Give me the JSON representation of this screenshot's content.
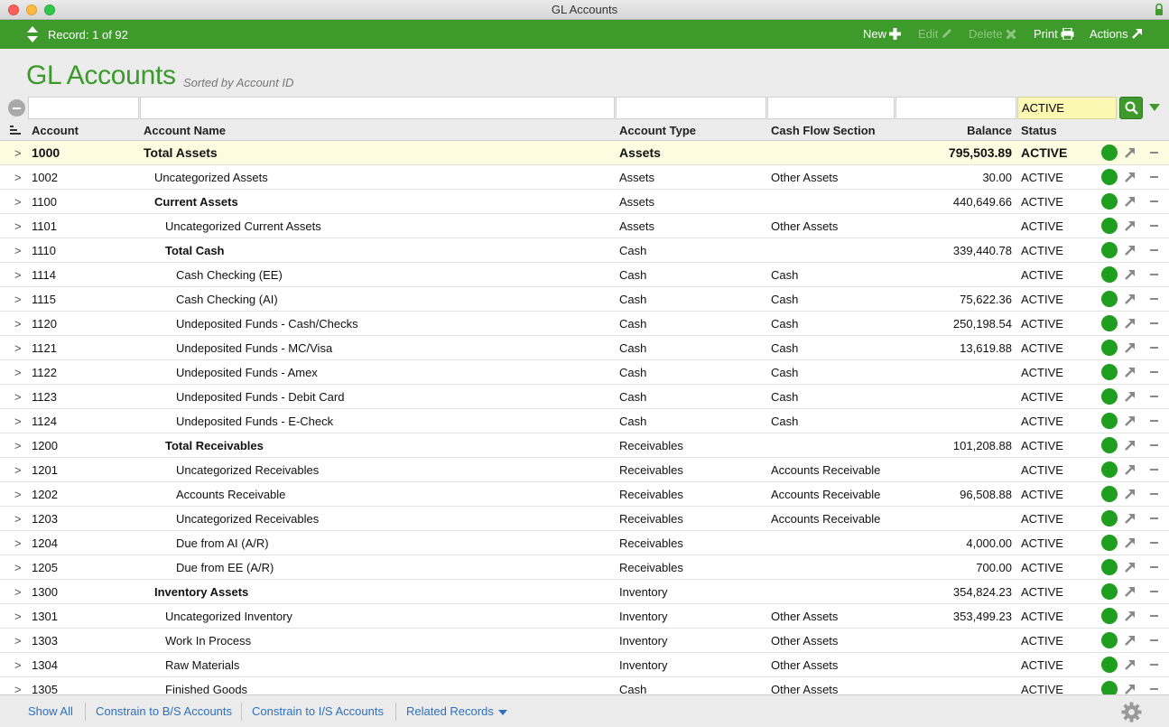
{
  "window": {
    "title": "GL Accounts"
  },
  "toolbar": {
    "record_label": "Record: 1 of 92",
    "new_label": "New",
    "edit_label": "Edit",
    "delete_label": "Delete",
    "print_label": "Print",
    "actions_label": "Actions"
  },
  "header": {
    "title": "GL Accounts",
    "subtitle": "Sorted by Account ID"
  },
  "filters": {
    "status_value": "ACTIVE"
  },
  "columns": {
    "account": "Account",
    "account_name": "Account Name",
    "account_type": "Account Type",
    "cash_flow_section": "Cash Flow Section",
    "balance": "Balance",
    "status": "Status"
  },
  "rows": [
    {
      "account": "1000",
      "name": "Total Assets",
      "type": "Assets",
      "cash_flow": "",
      "balance": "795,503.89",
      "status": "ACTIVE",
      "level": 1
    },
    {
      "account": "1002",
      "name": "Uncategorized Assets",
      "type": "Assets",
      "cash_flow": "Other Assets",
      "balance": "30.00",
      "status": "ACTIVE",
      "level": 2
    },
    {
      "account": "1100",
      "name": "Current Assets",
      "type": "Assets",
      "cash_flow": "",
      "balance": "440,649.66",
      "status": "ACTIVE",
      "level": 2,
      "bold": true
    },
    {
      "account": "1101",
      "name": "Uncategorized Current Assets",
      "type": "Assets",
      "cash_flow": "Other Assets",
      "balance": "",
      "status": "ACTIVE",
      "level": 3
    },
    {
      "account": "1110",
      "name": "Total Cash",
      "type": "Cash",
      "cash_flow": "",
      "balance": "339,440.78",
      "status": "ACTIVE",
      "level": 3,
      "bold": true
    },
    {
      "account": "1114",
      "name": "Cash Checking (EE)",
      "type": "Cash",
      "cash_flow": "Cash",
      "balance": "",
      "status": "ACTIVE",
      "level": 4
    },
    {
      "account": "1115",
      "name": "Cash Checking (AI)",
      "type": "Cash",
      "cash_flow": "Cash",
      "balance": "75,622.36",
      "status": "ACTIVE",
      "level": 4
    },
    {
      "account": "1120",
      "name": "Undeposited Funds - Cash/Checks",
      "type": "Cash",
      "cash_flow": "Cash",
      "balance": "250,198.54",
      "status": "ACTIVE",
      "level": 4
    },
    {
      "account": "1121",
      "name": "Undeposited Funds - MC/Visa",
      "type": "Cash",
      "cash_flow": "Cash",
      "balance": "13,619.88",
      "status": "ACTIVE",
      "level": 4
    },
    {
      "account": "1122",
      "name": "Undeposited Funds - Amex",
      "type": "Cash",
      "cash_flow": "Cash",
      "balance": "",
      "status": "ACTIVE",
      "level": 4
    },
    {
      "account": "1123",
      "name": "Undeposited Funds - Debit Card",
      "type": "Cash",
      "cash_flow": "Cash",
      "balance": "",
      "status": "ACTIVE",
      "level": 4
    },
    {
      "account": "1124",
      "name": "Undeposited Funds - E-Check",
      "type": "Cash",
      "cash_flow": "Cash",
      "balance": "",
      "status": "ACTIVE",
      "level": 4
    },
    {
      "account": "1200",
      "name": "Total Receivables",
      "type": "Receivables",
      "cash_flow": "",
      "balance": "101,208.88",
      "status": "ACTIVE",
      "level": 3,
      "bold": true
    },
    {
      "account": "1201",
      "name": "Uncategorized Receivables",
      "type": "Receivables",
      "cash_flow": "Accounts Receivable",
      "balance": "",
      "status": "ACTIVE",
      "level": 4
    },
    {
      "account": "1202",
      "name": "Accounts Receivable",
      "type": "Receivables",
      "cash_flow": "Accounts Receivable",
      "balance": "96,508.88",
      "status": "ACTIVE",
      "level": 4
    },
    {
      "account": "1203",
      "name": "Uncategorized Receivables",
      "type": "Receivables",
      "cash_flow": "Accounts Receivable",
      "balance": "",
      "status": "ACTIVE",
      "level": 4
    },
    {
      "account": "1204",
      "name": "Due from AI (A/R)",
      "type": "Receivables",
      "cash_flow": "",
      "balance": "4,000.00",
      "status": "ACTIVE",
      "level": 4
    },
    {
      "account": "1205",
      "name": "Due from EE (A/R)",
      "type": "Receivables",
      "cash_flow": "",
      "balance": "700.00",
      "status": "ACTIVE",
      "level": 4
    },
    {
      "account": "1300",
      "name": "Inventory Assets",
      "type": "Inventory",
      "cash_flow": "",
      "balance": "354,824.23",
      "status": "ACTIVE",
      "level": 2,
      "bold": true
    },
    {
      "account": "1301",
      "name": "Uncategorized Inventory",
      "type": "Inventory",
      "cash_flow": "Other Assets",
      "balance": "353,499.23",
      "status": "ACTIVE",
      "level": 3
    },
    {
      "account": "1303",
      "name": "Work In Process",
      "type": "Inventory",
      "cash_flow": "Other Assets",
      "balance": "",
      "status": "ACTIVE",
      "level": 3
    },
    {
      "account": "1304",
      "name": "Raw Materials",
      "type": "Inventory",
      "cash_flow": "Other Assets",
      "balance": "",
      "status": "ACTIVE",
      "level": 3
    },
    {
      "account": "1305",
      "name": "Finished Goods",
      "type": "Cash",
      "cash_flow": "Other Assets",
      "balance": "",
      "status": "ACTIVE",
      "level": 3
    }
  ],
  "footer": {
    "show_all": "Show All",
    "constrain_bs": "Constrain to B/S Accounts",
    "constrain_is": "Constrain to I/S Accounts",
    "related_records": "Related Records"
  },
  "colors": {
    "accent": "#3f9a2c",
    "status_active": "#1f9e1f",
    "link": "#2c6fbf",
    "highlight_row": "#fdfbe0"
  }
}
